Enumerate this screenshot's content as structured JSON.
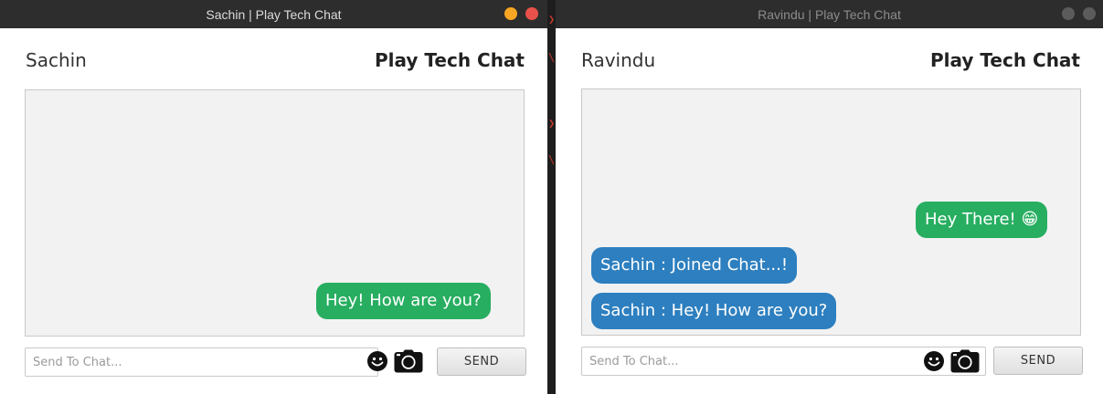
{
  "left_window": {
    "title": "Sachin | Play Tech Chat",
    "username": "Sachin",
    "app_title": "Play Tech Chat",
    "messages": [
      {
        "text": "Hey! How are you?",
        "direction": "outgoing"
      }
    ],
    "input_placeholder": "Send To Chat...",
    "send_label": "SEND"
  },
  "right_window": {
    "title": "Ravindu | Play Tech Chat",
    "username": "Ravindu",
    "app_title": "Play Tech Chat",
    "messages": [
      {
        "text": "Hey There! 😁",
        "direction": "outgoing"
      },
      {
        "text": "Sachin : Joined Chat...!",
        "direction": "incoming"
      },
      {
        "text": "Sachin : Hey! How are you?",
        "direction": "incoming"
      }
    ],
    "input_placeholder": "Send To Chat...",
    "send_label": "SEND"
  },
  "colors": {
    "outgoing_bubble": "#27ae60",
    "incoming_bubble": "#2d7fbf",
    "minimize_active": "#f6a623",
    "close_active": "#e8514a"
  },
  "icons": [
    "smiley-icon",
    "camera-icon"
  ]
}
